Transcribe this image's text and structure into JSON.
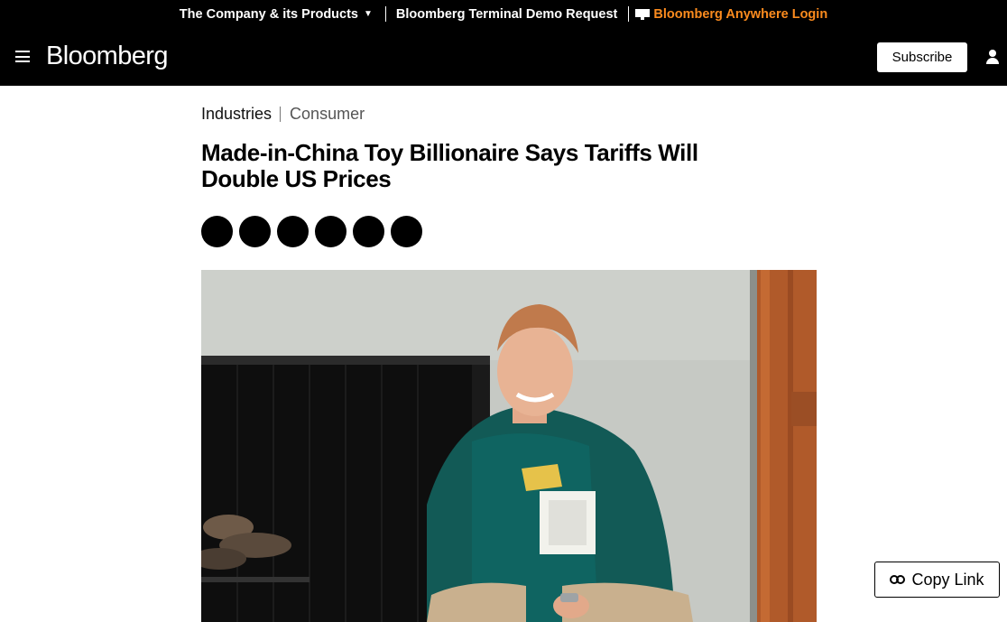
{
  "utility_bar": {
    "company_label": "The Company & its Products",
    "demo_label": "Bloomberg Terminal Demo Request",
    "anywhere_label": "Bloomberg Anywhere Login"
  },
  "nav": {
    "logo": "Bloomberg",
    "subscribe_label": "Subscribe"
  },
  "article": {
    "breadcrumb_primary": "Industries",
    "breadcrumb_secondary": "Consumer",
    "headline": "Made-in-China Toy Billionaire Says Tariffs Will Double US Prices",
    "share_buttons": [
      "share-1",
      "share-2",
      "share-3",
      "share-4",
      "share-5",
      "share-6"
    ],
    "hero_image": "Photo of a smiling man in a green sweater crouching in front of a fireplace"
  },
  "floating": {
    "copy_link_label": "Copy Link"
  },
  "colors": {
    "header_bg": "#000000",
    "anywhere_accent": "#fb8b1e",
    "page_bg": "#ffffff"
  },
  "icons": {
    "menu": "hamburger-icon",
    "caret": "caret-down-icon",
    "terminal": "terminal-icon",
    "account": "user-icon",
    "link": "link-icon"
  }
}
